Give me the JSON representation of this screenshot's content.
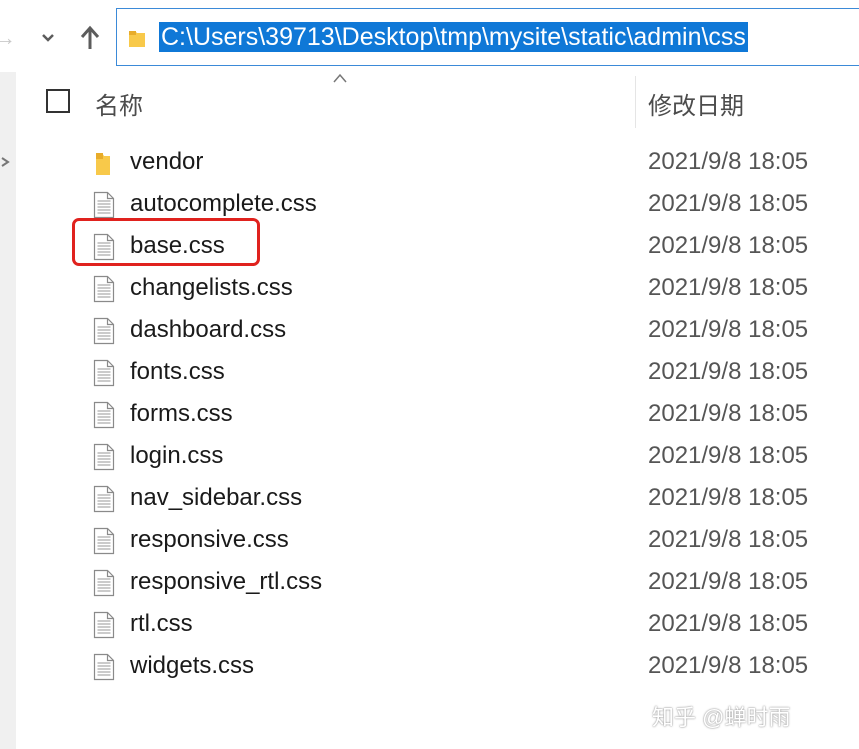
{
  "address_bar": {
    "path": "C:\\Users\\39713\\Desktop\\tmp\\mysite\\static\\admin\\css"
  },
  "nav": {
    "forward_icon": "arrow-right-icon",
    "recent_icon": "chevron-down-icon",
    "up_icon": "arrow-up-icon"
  },
  "header": {
    "name_label": "名称",
    "date_label": "修改日期"
  },
  "files": [
    {
      "name": "vendor",
      "date": "2021/9/8 18:05",
      "type": "folder"
    },
    {
      "name": "autocomplete.css",
      "date": "2021/9/8 18:05",
      "type": "file"
    },
    {
      "name": "base.css",
      "date": "2021/9/8 18:05",
      "type": "file",
      "highlighted": true
    },
    {
      "name": "changelists.css",
      "date": "2021/9/8 18:05",
      "type": "file"
    },
    {
      "name": "dashboard.css",
      "date": "2021/9/8 18:05",
      "type": "file"
    },
    {
      "name": "fonts.css",
      "date": "2021/9/8 18:05",
      "type": "file"
    },
    {
      "name": "forms.css",
      "date": "2021/9/8 18:05",
      "type": "file"
    },
    {
      "name": "login.css",
      "date": "2021/9/8 18:05",
      "type": "file"
    },
    {
      "name": "nav_sidebar.css",
      "date": "2021/9/8 18:05",
      "type": "file"
    },
    {
      "name": "responsive.css",
      "date": "2021/9/8 18:05",
      "type": "file"
    },
    {
      "name": "responsive_rtl.css",
      "date": "2021/9/8 18:05",
      "type": "file"
    },
    {
      "name": "rtl.css",
      "date": "2021/9/8 18:05",
      "type": "file"
    },
    {
      "name": "widgets.css",
      "date": "2021/9/8 18:05",
      "type": "file"
    }
  ],
  "watermark": "知乎 @蝉时雨",
  "colors": {
    "selection": "#0f78d7",
    "address_border": "#3b8ad8",
    "annotation": "#e0221e",
    "folder": "#f8c94a"
  }
}
